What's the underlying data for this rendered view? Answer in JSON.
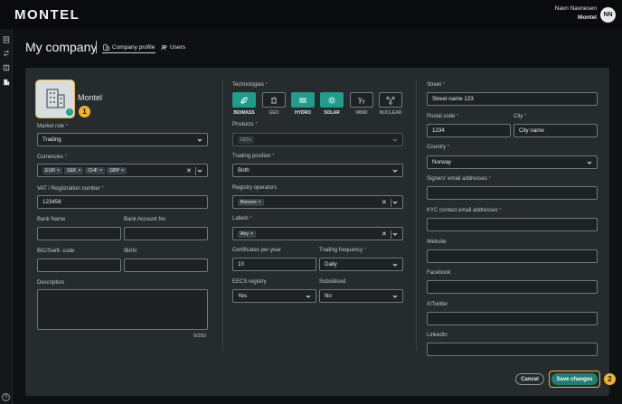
{
  "header": {
    "brand": "MONTEL",
    "user_name": "Navn Navnesen",
    "user_org": "Montel",
    "avatar_initials": "NN"
  },
  "page": {
    "title": "My company",
    "tabs": [
      {
        "label": "Company profile",
        "icon": "building-icon",
        "active": true
      },
      {
        "label": "Users",
        "icon": "users-icon",
        "active": false
      }
    ]
  },
  "sidebar": {
    "icons": [
      "document-icon",
      "exchange-icon",
      "book-icon",
      "building-icon"
    ],
    "help": "?"
  },
  "company": {
    "name": "Montel",
    "callout_1": "1"
  },
  "col1": {
    "market_role": {
      "label": "Market role",
      "value": "Trading"
    },
    "currencies": {
      "label": "Currencies",
      "chips": [
        "EUR",
        "SEK",
        "CHF",
        "GBP"
      ]
    },
    "vat": {
      "label": "VAT / Registration number",
      "value": "123456"
    },
    "bank_name": {
      "label": "Bank Name",
      "value": ""
    },
    "bank_account": {
      "label": "Bank Account No",
      "value": ""
    },
    "bic": {
      "label": "BIC/Swift- code",
      "value": ""
    },
    "iban": {
      "label": "IBAN",
      "value": ""
    },
    "description": {
      "label": "Description",
      "counter": "0/250"
    }
  },
  "col2": {
    "technologies": {
      "label": "Technologies",
      "items": [
        {
          "label": "BIOMASS",
          "icon": "leaf-icon",
          "on": true
        },
        {
          "label": "GEO",
          "icon": "geo-icon",
          "on": false
        },
        {
          "label": "HYDRO",
          "icon": "waves-icon",
          "on": true
        },
        {
          "label": "SOLAR",
          "icon": "sun-icon",
          "on": true
        },
        {
          "label": "WIND",
          "icon": "wind-icon",
          "on": false
        },
        {
          "label": "NUCLEAR",
          "icon": "atom-icon",
          "on": false
        }
      ]
    },
    "products": {
      "label": "Products",
      "chip": "GO's"
    },
    "trading_position": {
      "label": "Trading position",
      "value": "Both"
    },
    "registry_operators": {
      "label": "Registry operators",
      "chip": "Bonzen"
    },
    "labels": {
      "label": "Labels",
      "chip": "Any"
    },
    "certificates": {
      "label": "Certificates per year",
      "value": "10"
    },
    "trading_frequency": {
      "label": "Trading frequency",
      "value": "Daily"
    },
    "eecs": {
      "label": "EECS registry",
      "value": "Yes"
    },
    "subsidised": {
      "label": "Subsidised",
      "value": "No"
    }
  },
  "col3": {
    "street": {
      "label": "Street",
      "value": "Street name 123"
    },
    "postal": {
      "label": "Postal code",
      "value": "1234"
    },
    "city": {
      "label": "City",
      "value": "City name"
    },
    "country": {
      "label": "Country",
      "value": "Norway"
    },
    "signers_email": {
      "label": "Signers' email addresses",
      "value": ""
    },
    "kyc_email": {
      "label": "KYC contact email addresses",
      "value": ""
    },
    "website": {
      "label": "Website",
      "value": ""
    },
    "facebook": {
      "label": "Facebook",
      "value": ""
    },
    "twitter": {
      "label": "X/Twitter",
      "value": ""
    },
    "linkedin": {
      "label": "LinkedIn",
      "value": ""
    }
  },
  "footer": {
    "cancel": "Cancel",
    "save": "Save changes",
    "callout_2": "2"
  },
  "colors": {
    "accent": "#1f9c8a",
    "callout": "#f0b429",
    "required": "#e06b6b"
  }
}
